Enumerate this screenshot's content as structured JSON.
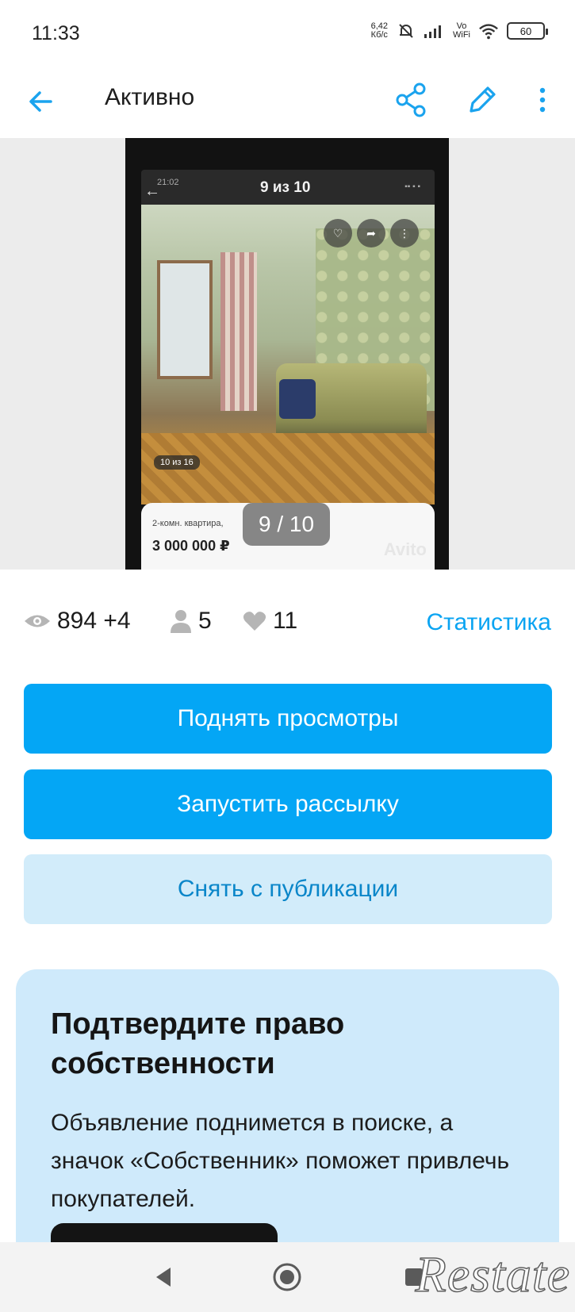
{
  "status_bar": {
    "time": "11:33",
    "net_speed_value": "6,42",
    "net_speed_unit": "Кб/с",
    "vowifi_top": "Vo",
    "vowifi_bottom": "WiFi",
    "battery": "60"
  },
  "app_bar": {
    "title": "Активно",
    "icons": [
      "arrow-back-icon",
      "share-icon",
      "edit-icon",
      "more-vertical-icon"
    ]
  },
  "gallery": {
    "pager": "9 / 10",
    "inner_screenshot": {
      "time": "21:02",
      "counter": "9 из 10",
      "photo_counter": "10 из 16",
      "description": "2-комн. квартира,",
      "price": "3 000 000 ₽",
      "watermark": "Avito"
    }
  },
  "stats": {
    "views": "894 +4",
    "contacts": "5",
    "favorites": "11",
    "link_label": "Статистика"
  },
  "actions": {
    "raise_views": "Поднять просмотры",
    "start_mailing": "Запустить рассылку",
    "unpublish": "Снять с публикации"
  },
  "promo": {
    "title": "Подтвердите право собственности",
    "text": "Объявление поднимется в поиске, а значок «Собственник» поможет привлечь покупателей."
  },
  "watermark": "Restate",
  "colors": {
    "accent": "#04a6f5",
    "link": "#0aa4f2",
    "secondary_bg": "#d2ecfa",
    "secondary_text": "#0a86c9",
    "promo_bg": "#cfeafb",
    "icon_blue": "#1aa3ee"
  }
}
